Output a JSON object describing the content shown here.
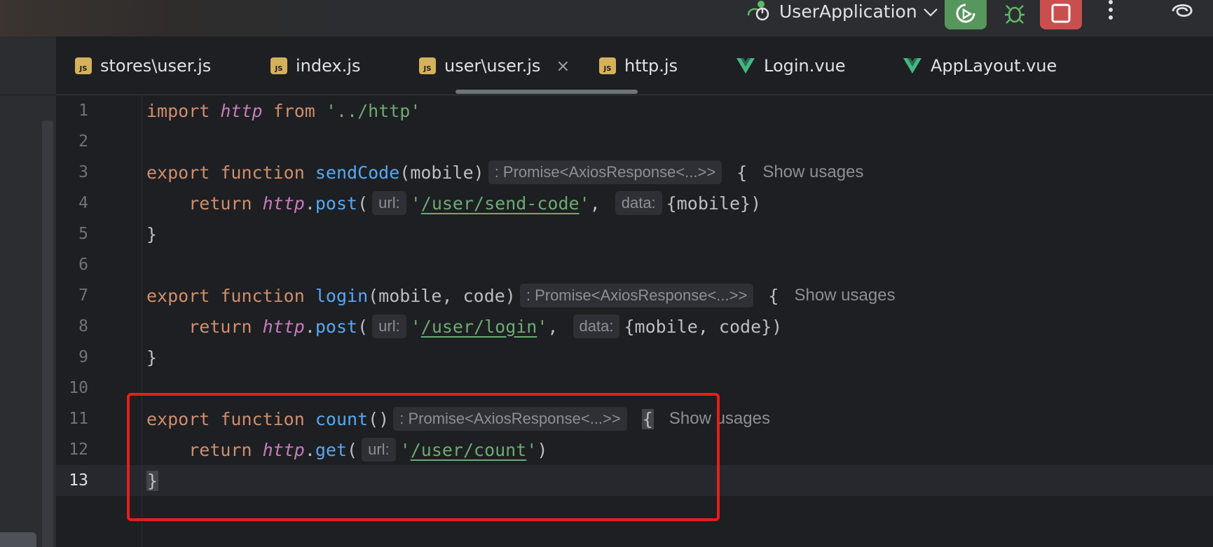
{
  "titlebar": {
    "run_config": "UserApplication",
    "icons": [
      "run-config-icon",
      "chevron-down-icon",
      "rerun-icon",
      "debug-icon",
      "stop-icon",
      "more-icon",
      "ai-assistant-icon"
    ]
  },
  "tabs": [
    {
      "label": "stores\\user.js",
      "type": "js",
      "active": false
    },
    {
      "label": "index.js",
      "type": "js",
      "active": false
    },
    {
      "label": "user\\user.js",
      "type": "js",
      "active": true
    },
    {
      "label": "http.js",
      "type": "js",
      "active": false
    },
    {
      "label": "Login.vue",
      "type": "vue",
      "active": false
    },
    {
      "label": "AppLayout.vue",
      "type": "vue",
      "active": false
    }
  ],
  "tab_close": "×",
  "js_badge": "JS",
  "editor": {
    "line_numbers": [
      "1",
      "2",
      "3",
      "4",
      "5",
      "6",
      "7",
      "8",
      "9",
      "10",
      "11",
      "12",
      "13"
    ],
    "current_line": 13,
    "tokens": {
      "import": "import",
      "http": "http",
      "from": "from",
      "http_path": "'../http'",
      "export": "export",
      "function": "function",
      "return": "return",
      "sendCode": "sendCode",
      "login": "login",
      "count": "count",
      "post": "post",
      "get": "get",
      "params_mobile": "(mobile)",
      "params_mobile_code": "(mobile, code)",
      "params_none": "()",
      "url_send_code": "/user/send-code",
      "url_login": "/user/login",
      "url_count": "/user/count",
      "data_mobile": "{mobile})",
      "data_mobile_code": "{mobile, code})",
      "open_brace": "{",
      "close_brace": "}",
      "dot": ".",
      "open_paren": "(",
      "quote": "'",
      "comma": ", ",
      "close_paren": ")"
    },
    "hints": {
      "return_type": ": Promise<AxiosResponse<...>>",
      "url": "url:",
      "data": "data:"
    },
    "show_usages": "Show usages"
  }
}
